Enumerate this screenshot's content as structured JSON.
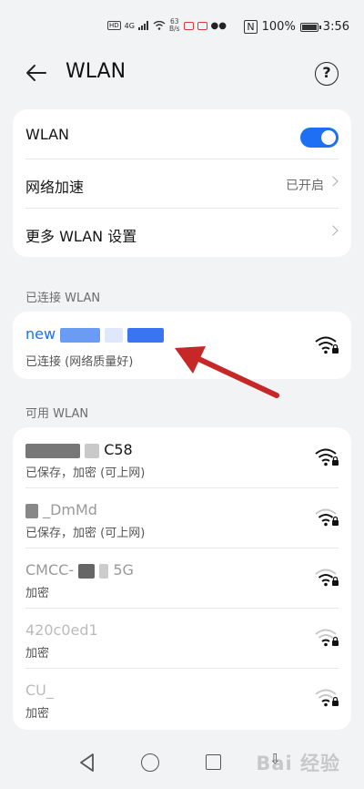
{
  "status_bar": {
    "hd": "HD",
    "signal": "4G",
    "speed_value": "63",
    "speed_unit": "B/s",
    "battery": "100%",
    "time": "3:56"
  },
  "header": {
    "title": "WLAN",
    "help_icon": "?"
  },
  "settings": {
    "wlan_label": "WLAN",
    "wlan_toggle_on": true,
    "accelerate_label": "网络加速",
    "accelerate_value": "已开启",
    "more_label": "更多 WLAN 设置"
  },
  "connected_section": {
    "label": "已连接 WLAN",
    "network": {
      "name": "new",
      "status": "已连接 (网络质量好)"
    }
  },
  "available_section": {
    "label": "可用 WLAN",
    "networks": [
      {
        "name": "C58",
        "status": "已保存，加密 (可上网)",
        "signal": "strong"
      },
      {
        "name": "_DmMd",
        "status": "已保存，加密 (可上网)",
        "signal": "medium"
      },
      {
        "name": "CMCC-",
        "name_suffix": "5G",
        "status": "加密",
        "signal": "medium"
      },
      {
        "name": "420c0ed1",
        "status": "加密",
        "signal": "weak"
      },
      {
        "name": "CU_",
        "status": "加密",
        "signal": "weak"
      }
    ]
  },
  "colors": {
    "accent": "#1f6ff5",
    "annotation_arrow": "#c62828"
  }
}
